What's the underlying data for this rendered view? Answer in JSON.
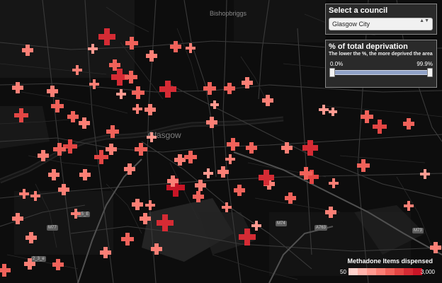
{
  "map": {
    "places": [
      {
        "name": "Bishopbriggs",
        "kind": "town"
      },
      {
        "name": "Glasgow",
        "kind": "city"
      }
    ],
    "road_labels": [
      "M77",
      "M74",
      "A763",
      "M73",
      "1_5_E",
      "2_3_e"
    ]
  },
  "council_panel": {
    "title": "Select a council",
    "selected": "Glasgow City",
    "arrows": "▲▼"
  },
  "deprivation_panel": {
    "title": "% of total deprivation",
    "subtitle": "The lower the %, the more deprived the area",
    "min_label": "0.0%",
    "max_label": "99.9%",
    "range_low": 0.0,
    "range_high": 99.9
  },
  "legend": {
    "title": "Methadone Items dispensed",
    "min_label": "50",
    "max_label": "3,000",
    "min_value": 50,
    "max_value": 3000,
    "ramp_colors": [
      "#ffd2cc",
      "#ffb3ab",
      "#ff9a90",
      "#fb7f75",
      "#f0625a",
      "#e34644",
      "#d52b34",
      "#c81526"
    ]
  },
  "pharmacies": [
    {
      "id": 1,
      "items": 1800
    },
    {
      "id": 2,
      "items": 600
    },
    {
      "id": 3,
      "items": 350
    },
    {
      "id": 4,
      "items": 200
    },
    {
      "id": 5,
      "items": 400
    },
    {
      "id": 6,
      "items": 250
    },
    {
      "id": 7,
      "items": 300
    },
    {
      "id": 8,
      "items": 2200
    },
    {
      "id": 9,
      "items": 400
    },
    {
      "id": 10,
      "items": 250
    },
    {
      "id": 11,
      "items": 300
    },
    {
      "id": 12,
      "items": 350
    },
    {
      "id": 13,
      "items": 250
    },
    {
      "id": 14,
      "items": 1600
    },
    {
      "id": 15,
      "items": 600
    },
    {
      "id": 16,
      "items": 400
    },
    {
      "id": 17,
      "items": 300
    },
    {
      "id": 18,
      "items": 500
    },
    {
      "id": 19,
      "items": 500
    },
    {
      "id": 20,
      "items": 200
    },
    {
      "id": 21,
      "items": 250
    },
    {
      "id": 22,
      "items": 300
    },
    {
      "id": 23,
      "items": 150
    },
    {
      "id": 24,
      "items": 800
    },
    {
      "id": 25,
      "items": 500
    },
    {
      "id": 26,
      "items": 400
    },
    {
      "id": 27,
      "items": 350
    },
    {
      "id": 28,
      "items": 300
    },
    {
      "id": 29,
      "items": 200
    },
    {
      "id": 30,
      "items": 150
    },
    {
      "id": 31,
      "items": 700
    },
    {
      "id": 32,
      "items": 600
    },
    {
      "id": 33,
      "items": 400
    },
    {
      "id": 34,
      "items": 300
    },
    {
      "id": 35,
      "items": 500
    },
    {
      "id": 36,
      "items": 200
    },
    {
      "id": 37,
      "items": 800
    },
    {
      "id": 38,
      "items": 500
    },
    {
      "id": 39,
      "items": 350
    },
    {
      "id": 40,
      "items": 700
    },
    {
      "id": 41,
      "items": 500
    },
    {
      "id": 42,
      "items": 350
    },
    {
      "id": 43,
      "items": 1500
    },
    {
      "id": 44,
      "items": 400
    },
    {
      "id": 45,
      "items": 300
    },
    {
      "id": 46,
      "items": 500
    },
    {
      "id": 47,
      "items": 300
    },
    {
      "id": 48,
      "items": 500
    },
    {
      "id": 49,
      "items": 250
    },
    {
      "id": 50,
      "items": 300
    },
    {
      "id": 51,
      "items": 200
    },
    {
      "id": 52,
      "items": 300
    },
    {
      "id": 53,
      "items": 3000
    },
    {
      "id": 54,
      "items": 350
    },
    {
      "id": 55,
      "items": 300
    },
    {
      "id": 56,
      "items": 1400
    },
    {
      "id": 57,
      "items": 900
    },
    {
      "id": 58,
      "items": 600
    },
    {
      "id": 59,
      "items": 450
    },
    {
      "id": 60,
      "items": 400
    },
    {
      "id": 61,
      "items": 300
    },
    {
      "id": 62,
      "items": 300
    },
    {
      "id": 63,
      "items": 250
    },
    {
      "id": 64,
      "items": 2000
    },
    {
      "id": 65,
      "items": 300
    },
    {
      "id": 66,
      "items": 300
    },
    {
      "id": 67,
      "items": 250
    },
    {
      "id": 68,
      "items": 600
    },
    {
      "id": 69,
      "items": 350
    },
    {
      "id": 70,
      "items": 300
    },
    {
      "id": 71,
      "items": 400
    },
    {
      "id": 72,
      "items": 250
    },
    {
      "id": 73,
      "items": 200
    },
    {
      "id": 74,
      "items": 1800
    },
    {
      "id": 75,
      "items": 300
    },
    {
      "id": 76,
      "items": 350
    },
    {
      "id": 77,
      "items": 500
    },
    {
      "id": 78,
      "items": 400
    },
    {
      "id": 79,
      "items": 300
    },
    {
      "id": 80,
      "items": 250
    },
    {
      "id": 81,
      "items": 300
    },
    {
      "id": 82,
      "items": 250
    },
    {
      "id": 83,
      "items": 300
    },
    {
      "id": 84,
      "items": 400
    },
    {
      "id": 85,
      "items": 250
    },
    {
      "id": 86,
      "items": 300
    },
    {
      "id": 87,
      "items": 250
    },
    {
      "id": 88,
      "items": 200
    },
    {
      "id": 89,
      "items": 350
    }
  ]
}
